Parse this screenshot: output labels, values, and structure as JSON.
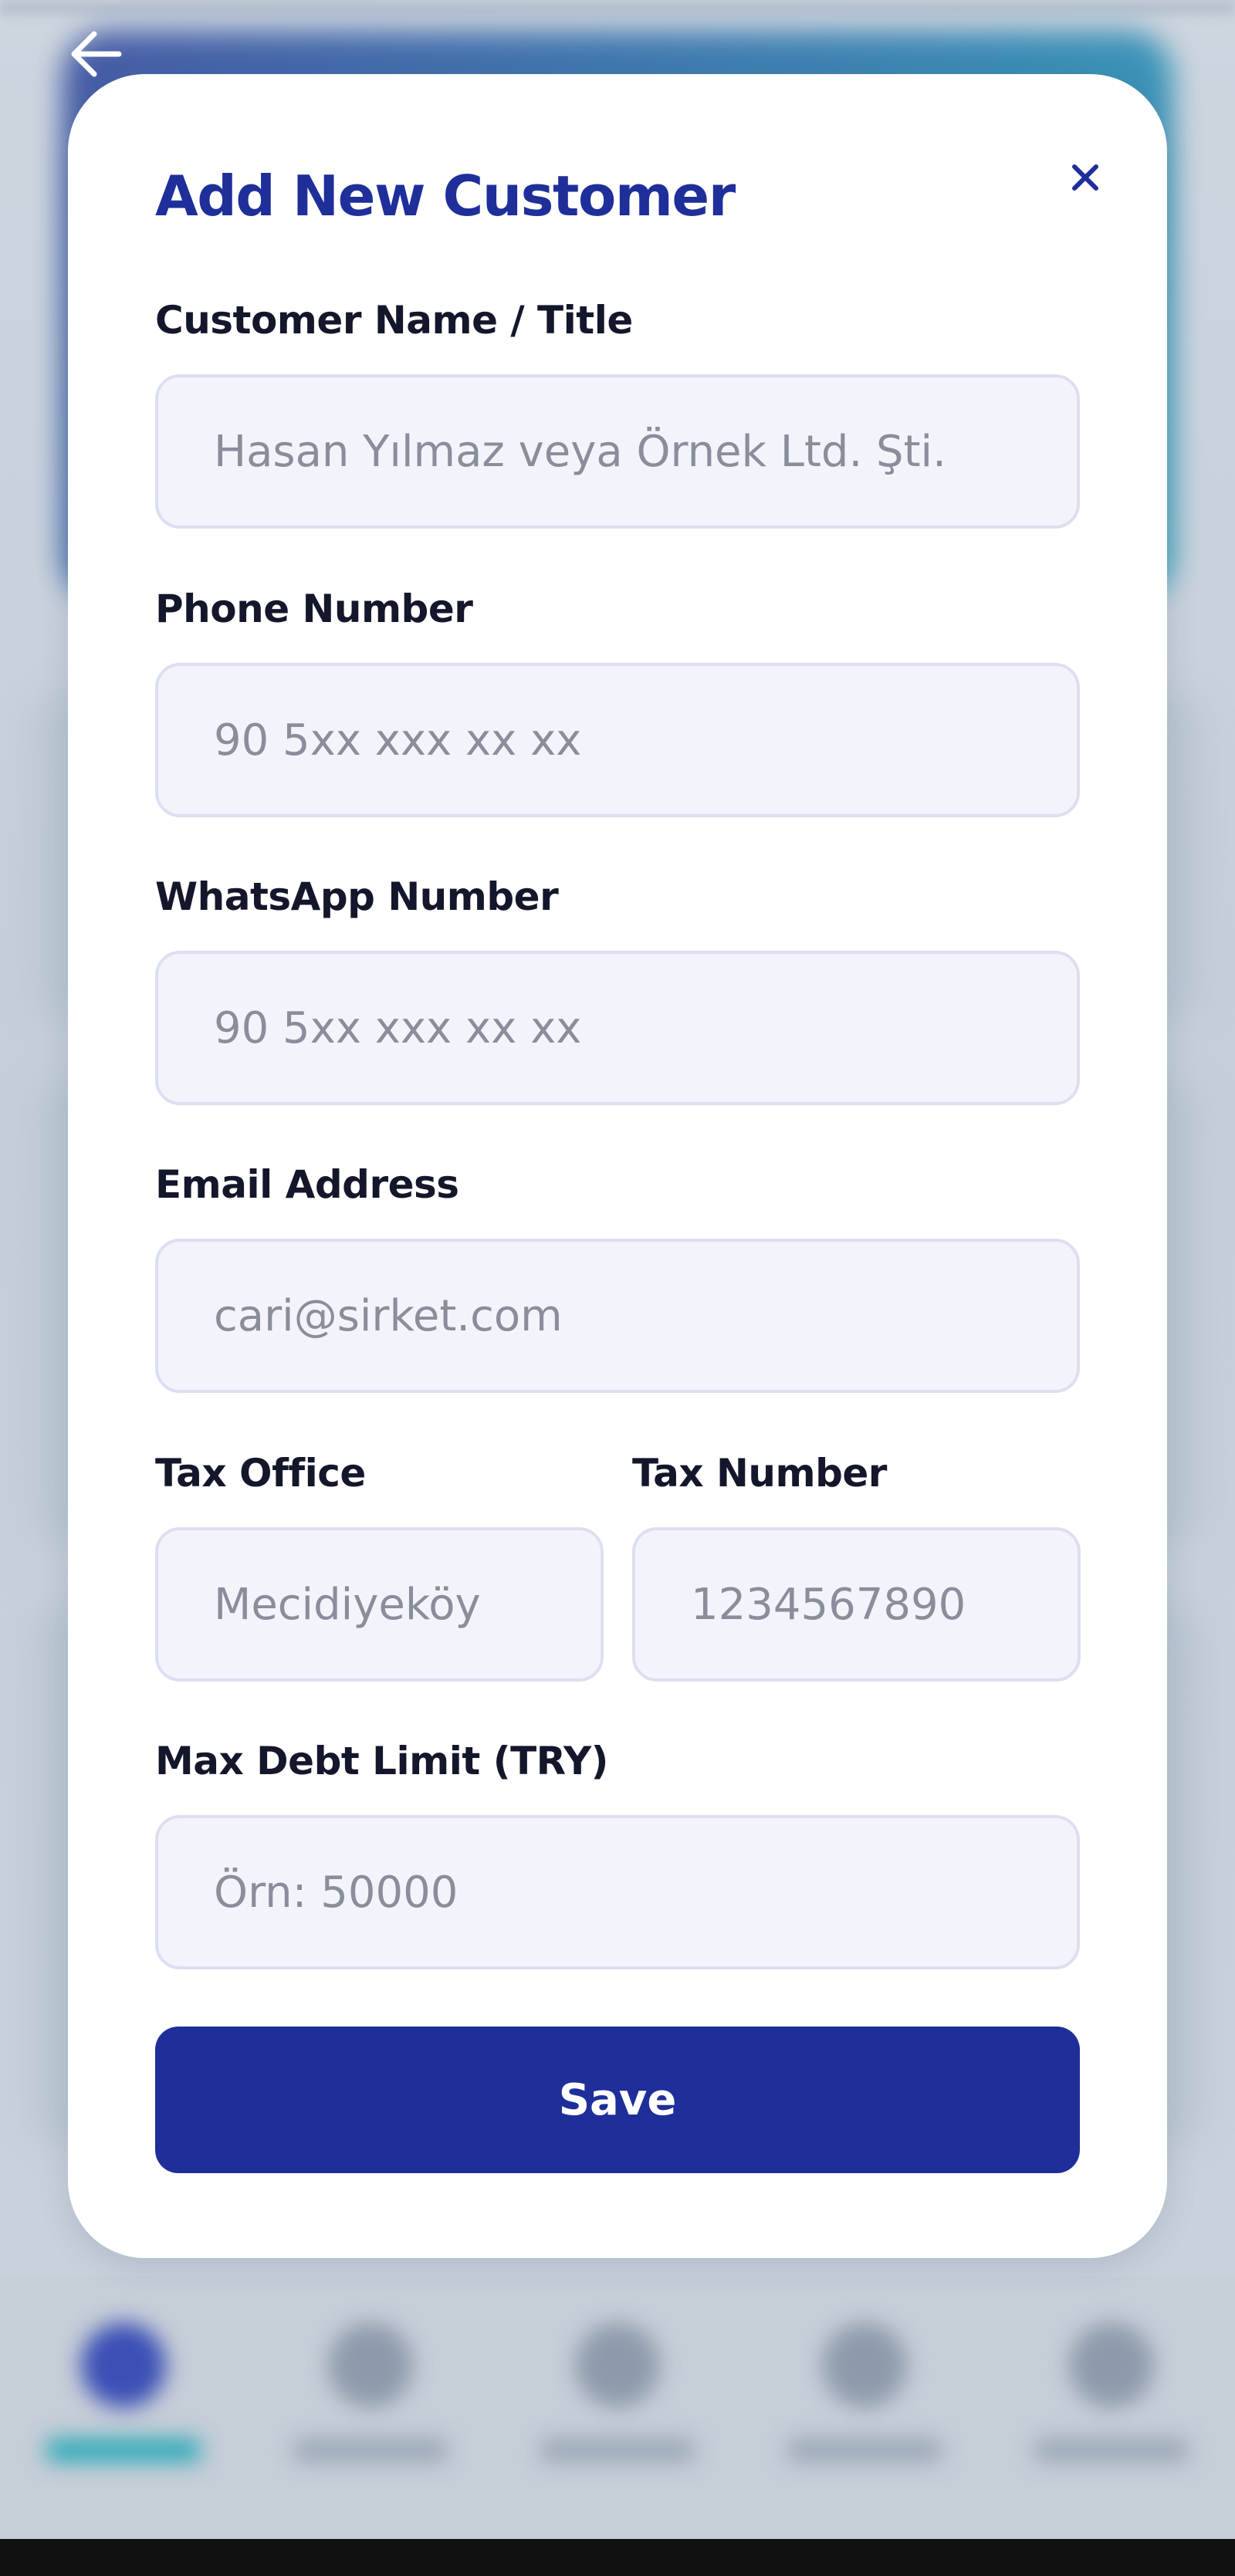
{
  "modal": {
    "title": "Add New Customer",
    "close_icon": "close-icon",
    "fields": {
      "customer_name": {
        "label": "Customer Name / Title",
        "placeholder": "Hasan Yılmaz veya Örnek Ltd. Şti.",
        "value": ""
      },
      "phone": {
        "label": "Phone Number",
        "placeholder": "90 5xx xxx xx xx",
        "value": ""
      },
      "whatsapp": {
        "label": "WhatsApp Number",
        "placeholder": "90 5xx xxx xx xx",
        "value": ""
      },
      "email": {
        "label": "Email Address",
        "placeholder": "cari@sirket.com",
        "value": ""
      },
      "tax_office": {
        "label": "Tax Office",
        "placeholder": "Mecidiyeköy",
        "value": ""
      },
      "tax_number": {
        "label": "Tax Number",
        "placeholder": "1234567890",
        "value": ""
      },
      "max_debt": {
        "label": "Max Debt Limit (TRY)",
        "placeholder": "Örn: 50000",
        "value": ""
      }
    },
    "save_label": "Save"
  },
  "header": {
    "back_icon": "arrow-left-icon"
  },
  "colors": {
    "accent": "#1e2f9a",
    "input_bg": "#f3f4fb",
    "input_border": "#dcdff0",
    "label_text": "#14172b",
    "placeholder_text": "#8a8d9a"
  }
}
